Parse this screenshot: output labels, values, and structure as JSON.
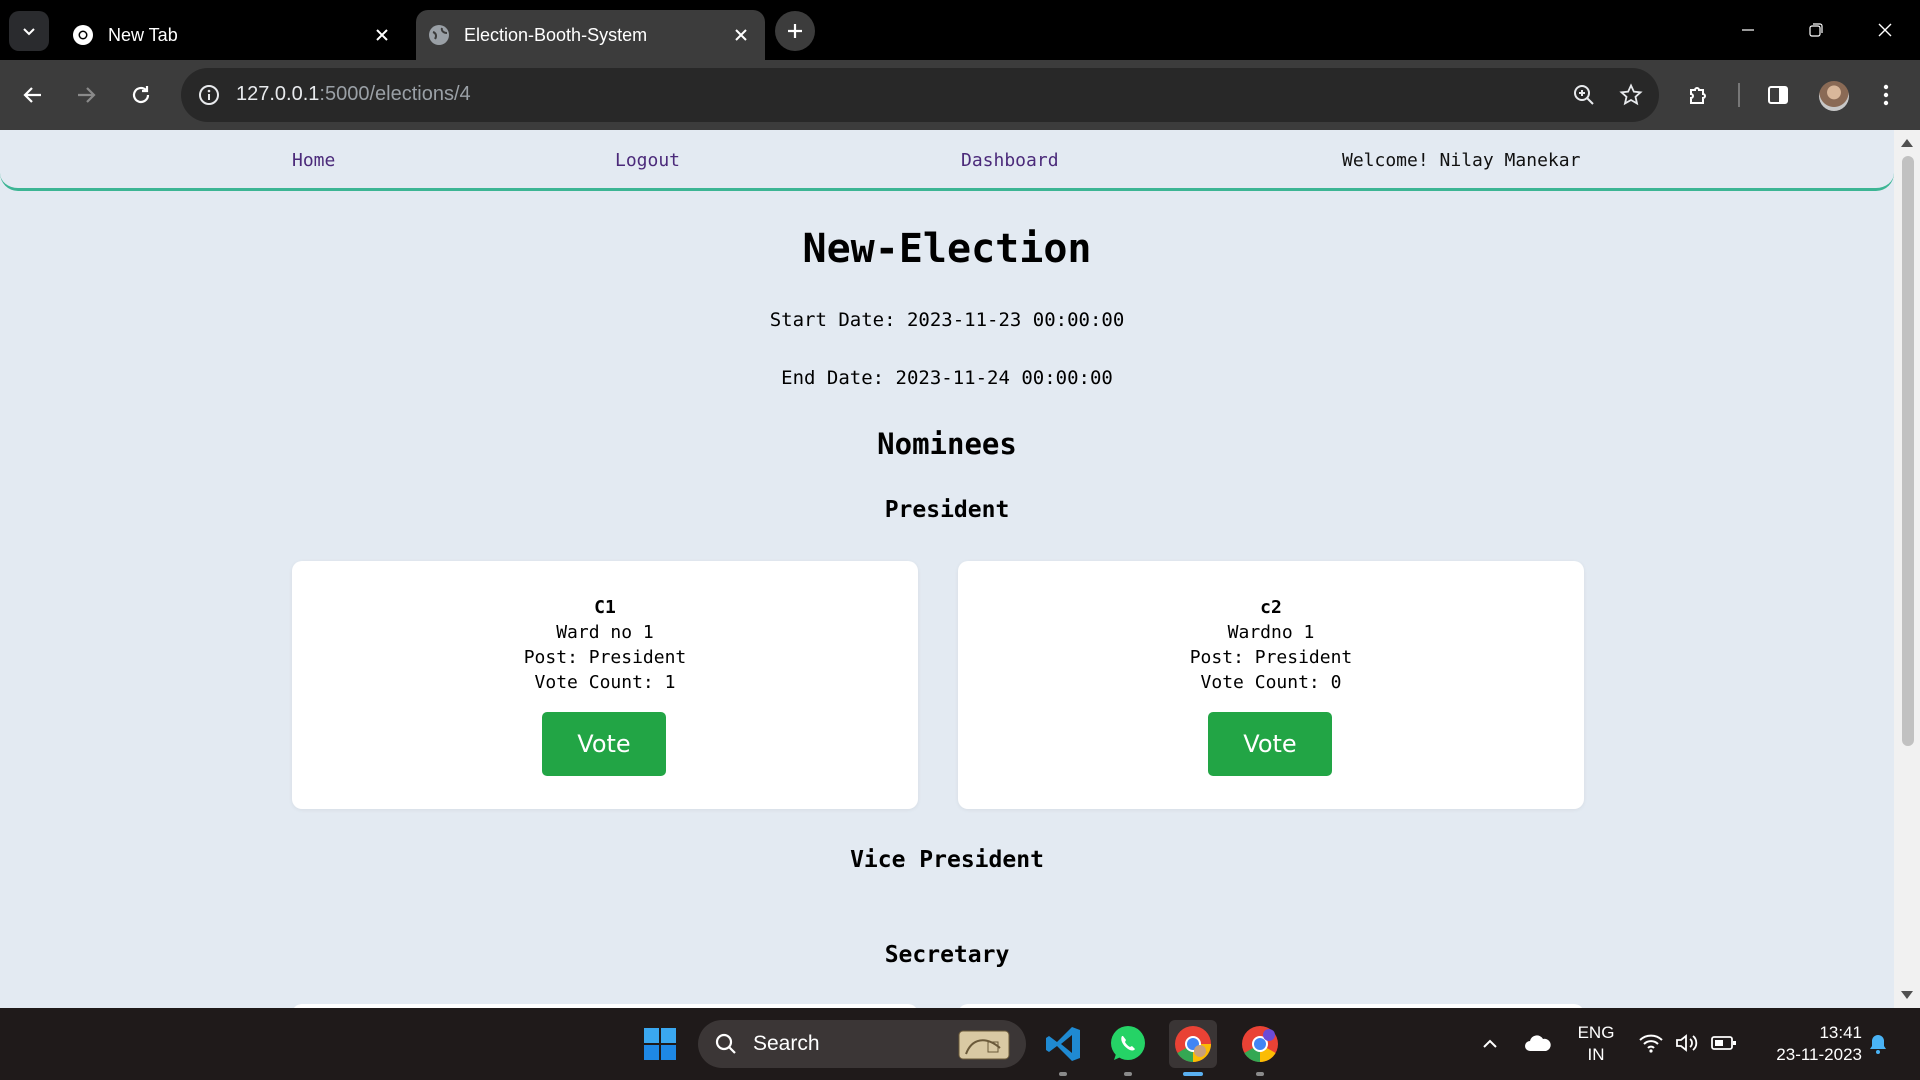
{
  "browser": {
    "tabs": [
      {
        "title": "New Tab",
        "active": false
      },
      {
        "title": "Election-Booth-System",
        "active": true
      }
    ],
    "url_host": "127.0.0.1",
    "url_path": ":5000/elections/4"
  },
  "nav": {
    "home": "Home",
    "logout": "Logout",
    "dashboard": "Dashboard",
    "welcome": "Welcome! Nilay Manekar"
  },
  "election": {
    "title": "New-Election",
    "start": "Start Date: 2023-11-23 00:00:00",
    "end": "End Date: 2023-11-24 00:00:00",
    "nominees_heading": "Nominees",
    "posts": [
      {
        "name": "President",
        "candidates": [
          {
            "name": "C1",
            "ward": "Ward no 1",
            "post": "Post: President",
            "votes": "Vote Count: 1",
            "button": "Vote"
          },
          {
            "name": "c2",
            "ward": "Wardno 1",
            "post": "Post: President",
            "votes": "Vote Count: 0",
            "button": "Vote"
          }
        ]
      },
      {
        "name": "Vice President",
        "candidates": []
      },
      {
        "name": "Secretary",
        "candidates": []
      }
    ]
  },
  "taskbar": {
    "search": "Search",
    "lang_top": "ENG",
    "lang_bottom": "IN",
    "time": "13:41",
    "date": "23-11-2023"
  },
  "colors": {
    "accent_green": "#22a545",
    "nav_underline": "#3cb594",
    "page_bg": "#e3eaf2"
  }
}
